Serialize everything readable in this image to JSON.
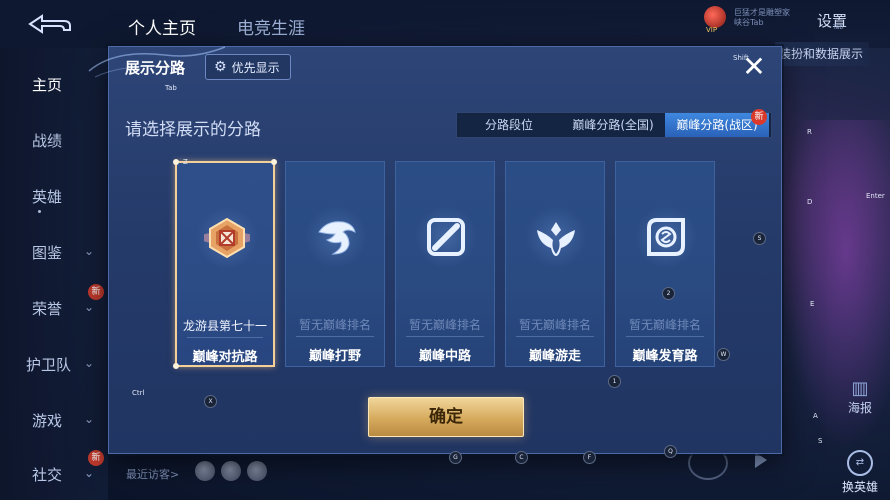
{
  "header": {
    "tabs": [
      "个人主页",
      "电竞生涯"
    ],
    "user_line1": "巨猛才是雕塑家",
    "user_line2": "峡谷Tab",
    "vip": "VIP",
    "settings_label": "设置",
    "settings_sub": "Tab",
    "right_button_label": "装扮和数据展示"
  },
  "sidebar": {
    "items": [
      {
        "label": "主页",
        "chevron": false,
        "badge": ""
      },
      {
        "label": "战绩",
        "chevron": false,
        "badge": ""
      },
      {
        "label": "英雄",
        "chevron": false,
        "badge": ""
      },
      {
        "label": "图鉴",
        "chevron": true,
        "badge": ""
      },
      {
        "label": "荣誉",
        "chevron": true,
        "badge": "新"
      },
      {
        "label": "护卫队",
        "chevron": true,
        "badge": ""
      },
      {
        "label": "游戏",
        "chevron": true,
        "badge": ""
      },
      {
        "label": "社交",
        "chevron": true,
        "badge": "新"
      }
    ],
    "recent_visitors_label": "最近访客>"
  },
  "right_panel": {
    "poster_label": "海报",
    "change_hero_label": "换英雄"
  },
  "modal": {
    "title": "展示分路",
    "priority_label": "优先显示",
    "close_symbol": "✕",
    "subtitle": "请选择展示的分路",
    "segments": [
      "分路段位",
      "巅峰分路(全国)",
      "巅峰分路(战区)"
    ],
    "active_segment": 2,
    "new_badge": "新",
    "cards": [
      {
        "name": "巅峰对抗路",
        "sub": "龙游县第七十一",
        "selected": true,
        "icon": "rank-badge-icon"
      },
      {
        "name": "巅峰打野",
        "sub": "暂无巅峰排名",
        "selected": false,
        "icon": "jungle-dragon-icon"
      },
      {
        "name": "巅峰中路",
        "sub": "暂无巅峰排名",
        "selected": false,
        "icon": "mid-lane-icon"
      },
      {
        "name": "巅峰游走",
        "sub": "暂无巅峰排名",
        "selected": false,
        "icon": "support-wings-icon"
      },
      {
        "name": "巅峰发育路",
        "sub": "暂无巅峰排名",
        "selected": false,
        "icon": "farm-lane-icon"
      }
    ],
    "confirm_label": "确定"
  },
  "key_hints": [
    "Z",
    "X",
    "R",
    "D",
    "S",
    "E",
    "W",
    "A",
    "S",
    "Q",
    "F",
    "C",
    "G",
    "1",
    "2",
    "Ctrl",
    "Shift",
    "Enter",
    "Tab"
  ],
  "colors": {
    "modal_bg": "#2a4276",
    "active_segment": "#3a7bd5",
    "selected_border": "#f4cf97",
    "confirm_gold": "#d6aa5d",
    "badge_red": "#d93a2c"
  }
}
